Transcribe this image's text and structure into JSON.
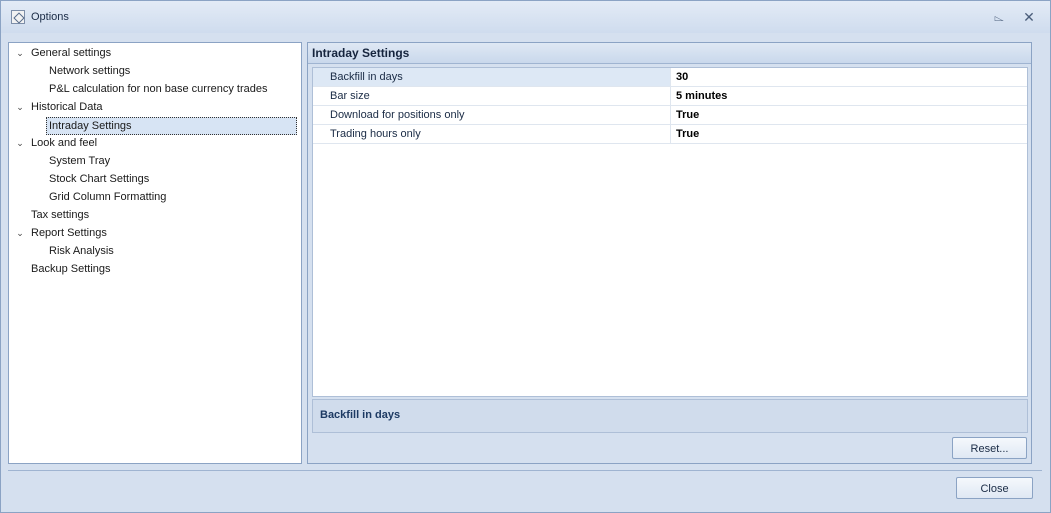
{
  "window": {
    "title": "Options"
  },
  "tree": {
    "items": [
      {
        "label": "General settings",
        "expandable": true
      },
      {
        "label": "Network settings"
      },
      {
        "label": "P&L calculation for non base currency trades"
      },
      {
        "label": "Historical Data",
        "expandable": true
      },
      {
        "label": "Intraday Settings",
        "selected": true
      },
      {
        "label": "Look and feel",
        "expandable": true
      },
      {
        "label": "System Tray"
      },
      {
        "label": "Stock Chart Settings"
      },
      {
        "label": "Grid Column Formatting"
      },
      {
        "label": "Tax settings"
      },
      {
        "label": "Report Settings",
        "expandable": true
      },
      {
        "label": "Risk Analysis"
      },
      {
        "label": "Backup Settings"
      }
    ]
  },
  "panel": {
    "title": "Intraday Settings",
    "properties": [
      {
        "name": "Backfill in days",
        "value": "30"
      },
      {
        "name": "Bar size",
        "value": "5 minutes"
      },
      {
        "name": "Download for positions only",
        "value": "True"
      },
      {
        "name": "Trading hours only",
        "value": "True"
      }
    ],
    "description": "Backfill in days",
    "reset_label": "Reset..."
  },
  "footer": {
    "close_label": "Close"
  },
  "icons": {
    "expand": "chevron-down-icon",
    "pin": "pin-icon",
    "close": "close-icon"
  }
}
